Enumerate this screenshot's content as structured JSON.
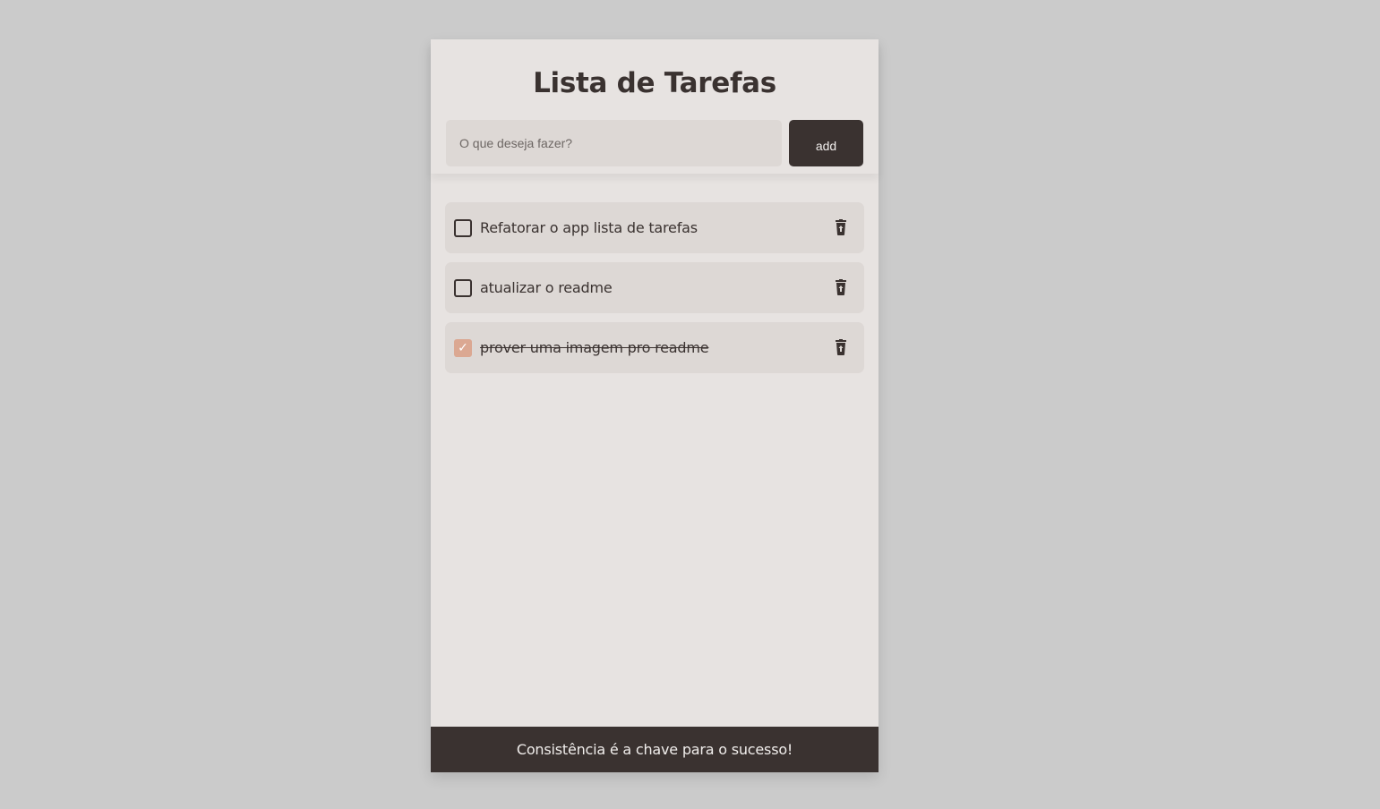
{
  "app": {
    "title": "Lista de Tarefas",
    "input": {
      "value": "",
      "placeholder": "O que deseja fazer?"
    },
    "add_label": "add"
  },
  "tasks": [
    {
      "text": "Refatorar o app lista de tarefas",
      "done": false
    },
    {
      "text": "atualizar o readme",
      "done": false
    },
    {
      "text": "prover uma imagem pro readme",
      "done": true
    }
  ],
  "footer": {
    "text": "Consistência é a chave para o sucesso!"
  },
  "icons": {
    "delete": "trash-icon",
    "check": "check-icon"
  },
  "colors": {
    "page_bg": "#cbcbcb",
    "card_bg": "#e7e3e1",
    "item_bg": "#ddd8d5",
    "dark": "#3a3230",
    "check_accent": "#dba892"
  }
}
